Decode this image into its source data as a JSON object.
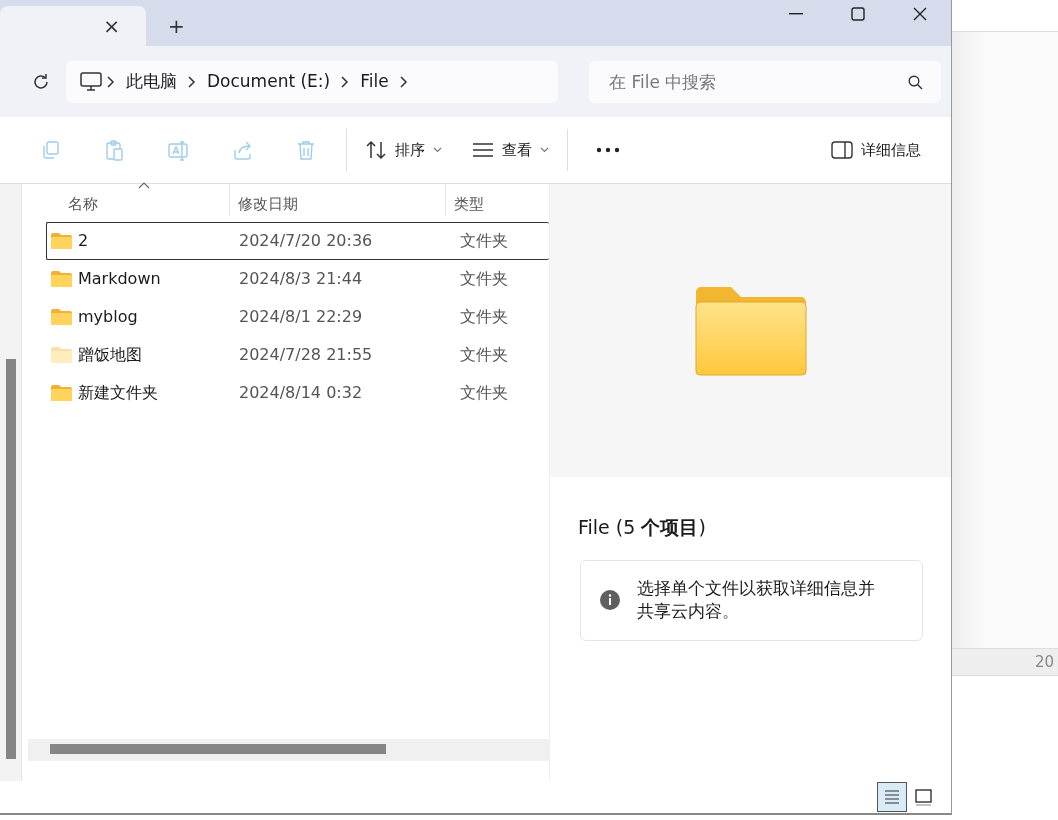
{
  "tab": {
    "close": "×",
    "new_tab": "+"
  },
  "address": {
    "crumbs": [
      "此电脑",
      "Document (E:)",
      "File"
    ]
  },
  "search": {
    "placeholder": "在 File 中搜索"
  },
  "toolbar": {
    "actions": [
      {
        "kind": "copy",
        "disabled": true
      },
      {
        "kind": "paste",
        "disabled": true
      },
      {
        "kind": "rename",
        "disabled": true
      },
      {
        "kind": "share",
        "disabled": true
      },
      {
        "kind": "delete",
        "disabled": true
      }
    ],
    "sort": "排序",
    "view": "查看",
    "details": "详细信息"
  },
  "table": {
    "columns": [
      {
        "label": "名称",
        "sorted": true
      },
      {
        "label": "修改日期",
        "sorted": false
      },
      {
        "label": "类型",
        "sorted": false
      }
    ],
    "rows": [
      {
        "name": "2",
        "date": "2024/7/20 20:36",
        "type": "文件夹",
        "selected": true,
        "hidden": false
      },
      {
        "name": "Markdown",
        "date": "2024/8/3 21:44",
        "type": "文件夹",
        "selected": false,
        "hidden": false
      },
      {
        "name": "myblog",
        "date": "2024/8/1 22:29",
        "type": "文件夹",
        "selected": false,
        "hidden": false
      },
      {
        "name": "蹭饭地图",
        "date": "2024/7/28 21:55",
        "type": "文件夹",
        "selected": false,
        "hidden": true
      },
      {
        "name": "新建文件夹",
        "date": "2024/8/14 0:32",
        "type": "文件夹",
        "selected": false,
        "hidden": false
      }
    ]
  },
  "details_pane": {
    "title": "File (5 **个项目**)",
    "info": "选择单个文件以获取详细信息并共享云内容。"
  },
  "status_bar": {
    "views": [
      {
        "kind": "details",
        "selected": true
      },
      {
        "kind": "tiles",
        "selected": false
      }
    ]
  },
  "background_window": {
    "text": "20"
  }
}
